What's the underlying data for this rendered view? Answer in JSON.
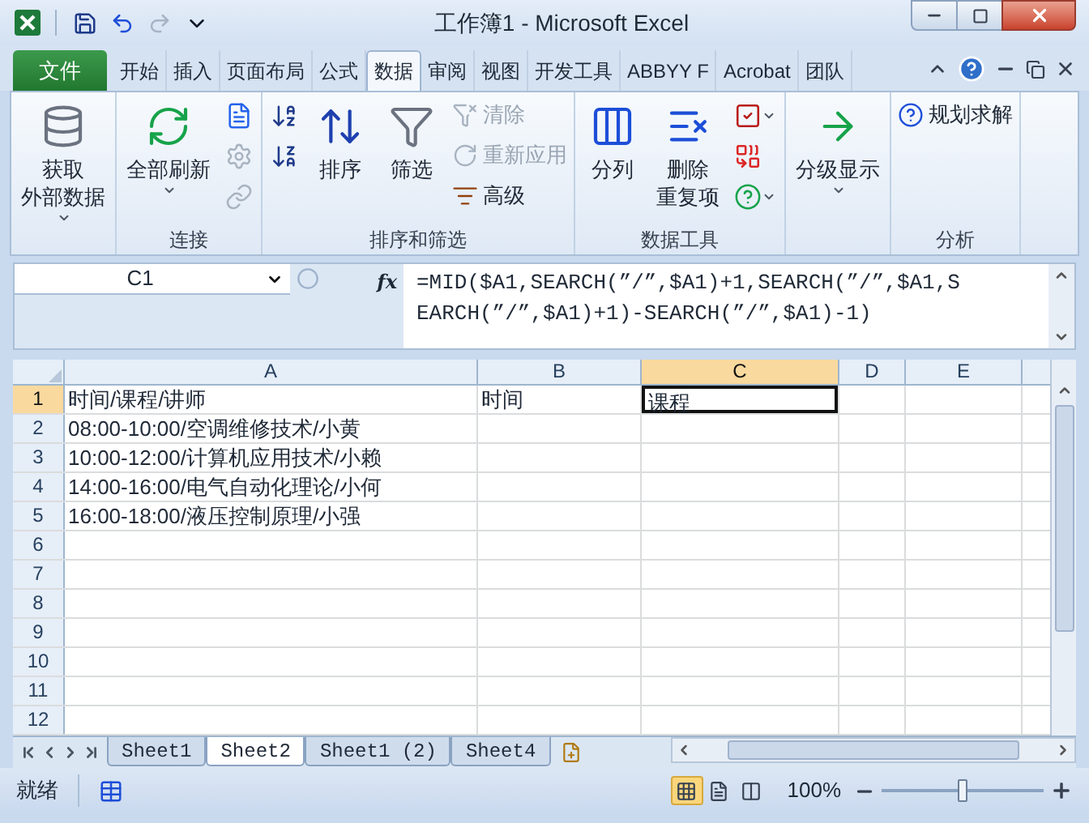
{
  "window": {
    "title": "工作簿1  -  Microsoft Excel"
  },
  "quick_access": [
    {
      "kind": "save",
      "disabled": false
    },
    {
      "kind": "undo",
      "disabled": false
    },
    {
      "kind": "redo",
      "disabled": true
    },
    {
      "kind": "customize",
      "disabled": false
    }
  ],
  "tabs": [
    {
      "label": "文件",
      "kind": "file",
      "selected": false
    },
    {
      "label": "开始",
      "kind": "tab",
      "selected": false
    },
    {
      "label": "插入",
      "kind": "tab",
      "selected": false
    },
    {
      "label": "页面布局",
      "kind": "tab",
      "selected": false
    },
    {
      "label": "公式",
      "kind": "tab",
      "selected": false
    },
    {
      "label": "数据",
      "kind": "tab",
      "selected": true
    },
    {
      "label": "审阅",
      "kind": "tab",
      "selected": false
    },
    {
      "label": "视图",
      "kind": "tab",
      "selected": false
    },
    {
      "label": "开发工具",
      "kind": "tab",
      "selected": false
    },
    {
      "label": "ABBYY F",
      "kind": "tab",
      "selected": false
    },
    {
      "label": "Acrobat",
      "kind": "tab",
      "selected": false
    },
    {
      "label": "团队",
      "kind": "tab",
      "selected": false
    }
  ],
  "ribbon_groups": [
    {
      "columns": [
        [
          {
            "kind": "large",
            "lines": [
              "获取",
              "外部数据"
            ],
            "dropdown": true,
            "disabled": false
          }
        ]
      ]
    },
    {
      "label": "连接",
      "columns": [
        [
          {
            "kind": "large",
            "lines": [
              "全部刷新"
            ],
            "dropdown": true,
            "disabled": false
          }
        ],
        [
          {
            "kind": "icon",
            "dropdown": false,
            "disabled": false
          },
          {
            "kind": "icon",
            "dropdown": false,
            "disabled": true
          },
          {
            "kind": "icon",
            "dropdown": false,
            "disabled": true
          }
        ]
      ]
    },
    {
      "label": "排序和筛选",
      "columns": [
        [
          {
            "kind": "icon",
            "dropdown": false,
            "disabled": false
          },
          {
            "kind": "icon",
            "dropdown": false,
            "disabled": false
          }
        ],
        [
          {
            "kind": "large",
            "lines": [
              "排序"
            ],
            "dropdown": false,
            "disabled": false
          }
        ],
        [
          {
            "kind": "large",
            "lines": [
              "筛选"
            ],
            "dropdown": false,
            "disabled": false
          }
        ],
        [
          {
            "kind": "small",
            "label": "清除",
            "dropdown": false,
            "disabled": true
          },
          {
            "kind": "small",
            "label": "重新应用",
            "dropdown": false,
            "disabled": true
          },
          {
            "kind": "small",
            "label": "高级",
            "dropdown": false,
            "disabled": false
          }
        ]
      ]
    },
    {
      "label": "数据工具",
      "columns": [
        [
          {
            "kind": "large",
            "lines": [
              "分列"
            ],
            "dropdown": false,
            "disabled": false
          }
        ],
        [
          {
            "kind": "large",
            "lines": [
              "删除",
              "重复项"
            ],
            "dropdown": false,
            "disabled": false
          }
        ],
        [
          {
            "kind": "icon",
            "dropdown": true,
            "disabled": false
          },
          {
            "kind": "icon",
            "dropdown": false,
            "disabled": false
          },
          {
            "kind": "icon",
            "dropdown": true,
            "disabled": false
          }
        ]
      ]
    },
    {
      "columns": [
        [
          {
            "kind": "large",
            "lines": [
              "分级显示"
            ],
            "dropdown": true,
            "disabled": false
          }
        ]
      ]
    },
    {
      "label": "分析",
      "columns": [
        [
          {
            "kind": "small",
            "label": "规划求解",
            "dropdown": false,
            "disabled": false
          }
        ]
      ]
    }
  ],
  "name_box": {
    "value": "C1"
  },
  "insert_function": "fx",
  "formula": "=MID($A1,SEARCH(”/”,$A1)+1,SEARCH(”/”,$A1,SEARCH(”/”,$A1)+1)-SEARCH(”/”,$A1)-1)",
  "columns": [
    {
      "label": "A",
      "selected": false
    },
    {
      "label": "B",
      "selected": false
    },
    {
      "label": "C",
      "selected": true
    },
    {
      "label": "D",
      "selected": false
    },
    {
      "label": "E",
      "selected": false
    }
  ],
  "rows": [
    {
      "header": "1",
      "selected": true,
      "cells": [
        {
          "text": "时间/课程/讲师",
          "selected": false
        },
        {
          "text": "时间",
          "selected": false
        },
        {
          "text": "课程",
          "selected": true
        }
      ]
    },
    {
      "header": "2",
      "selected": false,
      "cells": [
        {
          "text": "08:00-10:00/空调维修技术/小黄",
          "selected": false
        }
      ]
    },
    {
      "header": "3",
      "selected": false,
      "cells": [
        {
          "text": "10:00-12:00/计算机应用技术/小赖",
          "selected": false
        }
      ]
    },
    {
      "header": "4",
      "selected": false,
      "cells": [
        {
          "text": "14:00-16:00/电气自动化理论/小何",
          "selected": false
        }
      ]
    },
    {
      "header": "5",
      "selected": false,
      "cells": [
        {
          "text": "16:00-18:00/液压控制原理/小强",
          "selected": false
        }
      ]
    },
    {
      "header": "6",
      "selected": false
    },
    {
      "header": "7",
      "selected": false
    },
    {
      "header": "8",
      "selected": false
    },
    {
      "header": "9",
      "selected": false
    },
    {
      "header": "10",
      "selected": false
    },
    {
      "header": "11",
      "selected": false
    },
    {
      "header": "12",
      "selected": false
    }
  ],
  "sheet_tabs": [
    {
      "label": "Sheet1",
      "selected": false
    },
    {
      "label": "Sheet2",
      "selected": true
    },
    {
      "label": "Sheet1 (2)",
      "selected": false
    },
    {
      "label": "Sheet4",
      "selected": false
    }
  ],
  "status_bar": {
    "text": "就绪",
    "views": [
      {
        "kind": "normal",
        "selected": true
      },
      {
        "kind": "page_layout",
        "selected": false
      },
      {
        "kind": "page_break",
        "selected": false
      }
    ],
    "zoom": {
      "reading": "100%",
      "level": 0.5
    }
  }
}
